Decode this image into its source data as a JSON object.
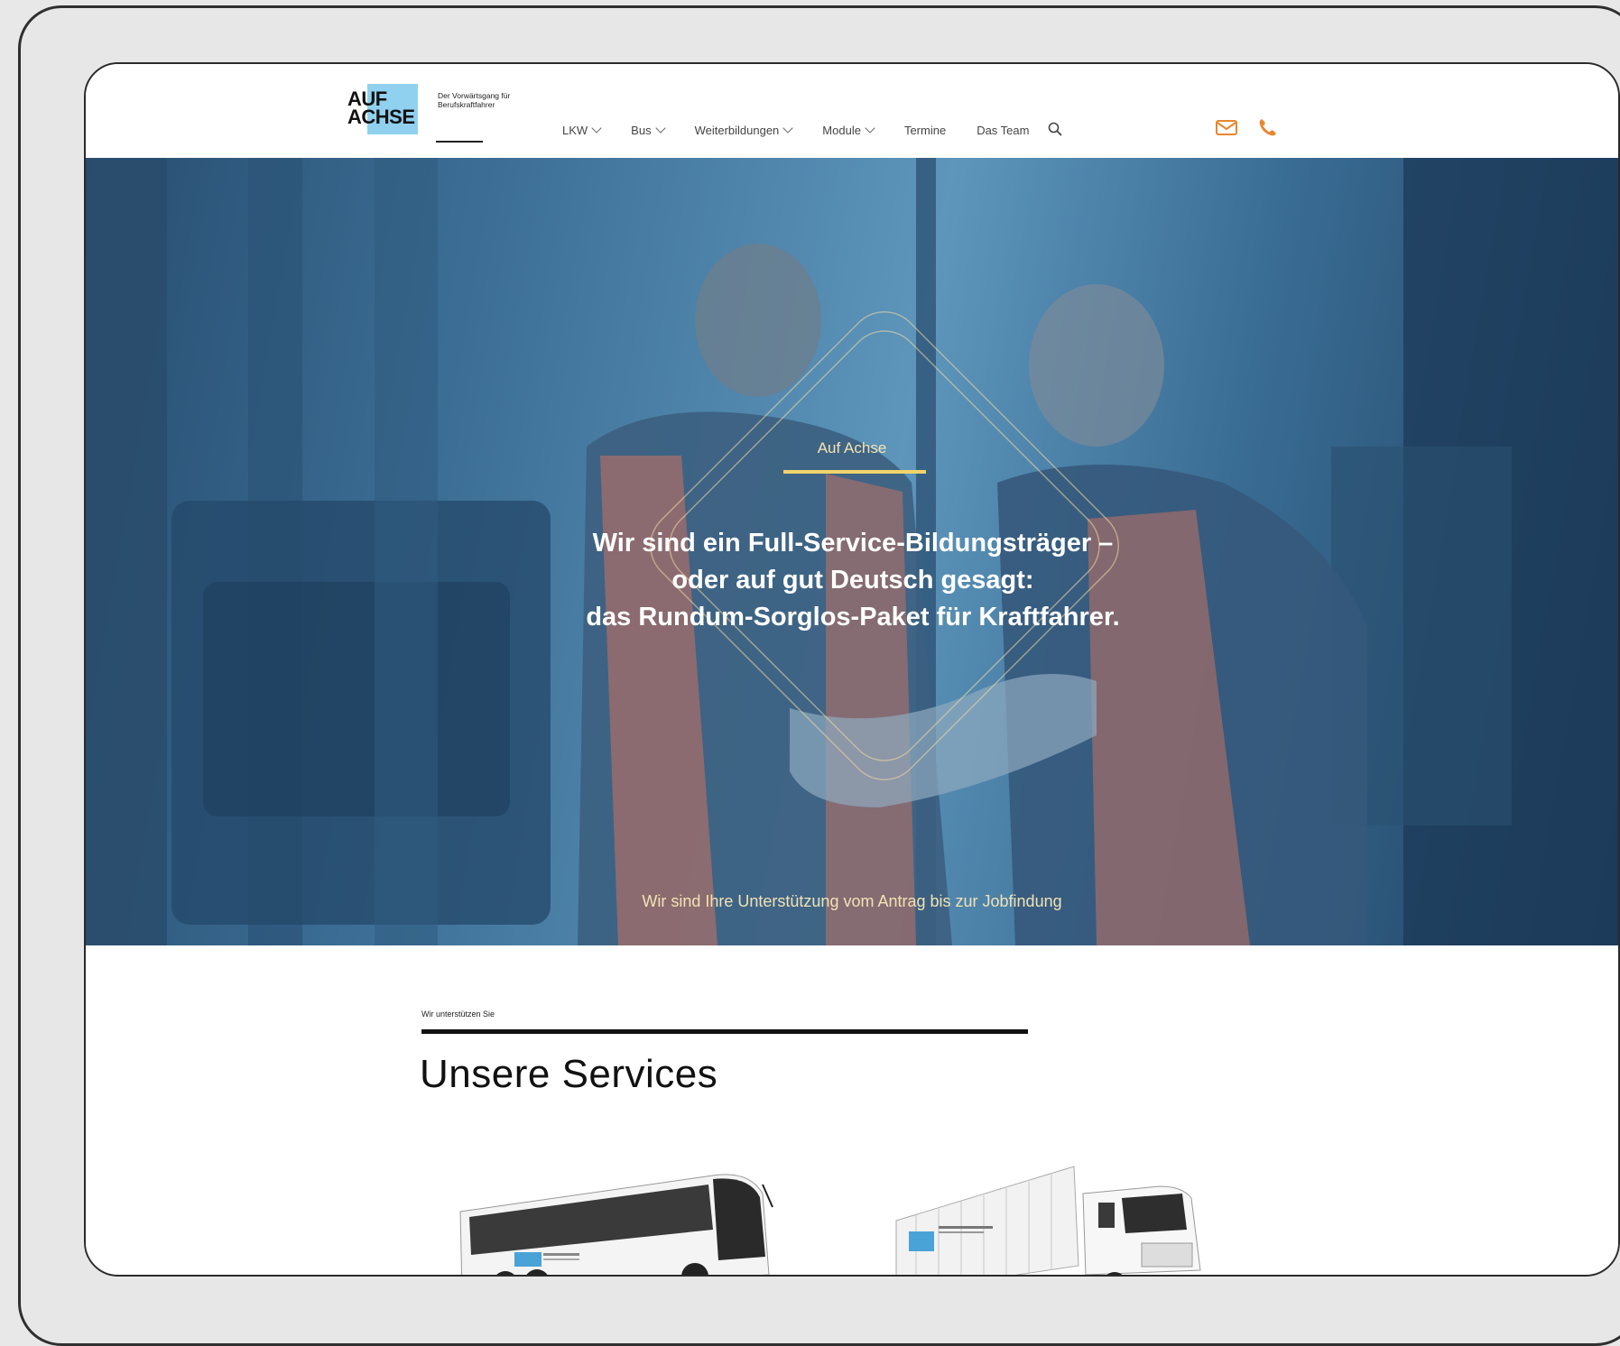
{
  "logo": {
    "word_1": "AUF",
    "word_2": "ACHSE",
    "tagline": "Der Vorwärtsgang für Berufskraftfahrer"
  },
  "nav": {
    "items": [
      {
        "label": "LKW",
        "dropdown": true
      },
      {
        "label": "Bus",
        "dropdown": true
      },
      {
        "label": "Weiterbildungen",
        "dropdown": true
      },
      {
        "label": "Module",
        "dropdown": true
      },
      {
        "label": "Termine",
        "dropdown": false
      },
      {
        "label": "Das Team",
        "dropdown": false
      }
    ],
    "search_icon": "search-icon",
    "mail_icon": "mail-icon",
    "phone_icon": "phone-icon"
  },
  "hero": {
    "eyebrow": "Auf Achse",
    "heading_lines": [
      "Wir sind ein Full-Service-Bildungsträger –",
      "oder auf gut Deutsch gesagt:",
      "das Rundum-Sorglos-Paket für Kraftfahrer."
    ],
    "subtitle": "Wir sind Ihre Unterstützung vom Antrag bis zur Jobfindung"
  },
  "services": {
    "eyebrow": "Wir unterstützen Sie",
    "title": "Unsere Services"
  },
  "colors": {
    "accent_orange": "#e8862f",
    "hero_blue": "#3d6f96",
    "eyebrow_yellow": "#f0d46b"
  }
}
